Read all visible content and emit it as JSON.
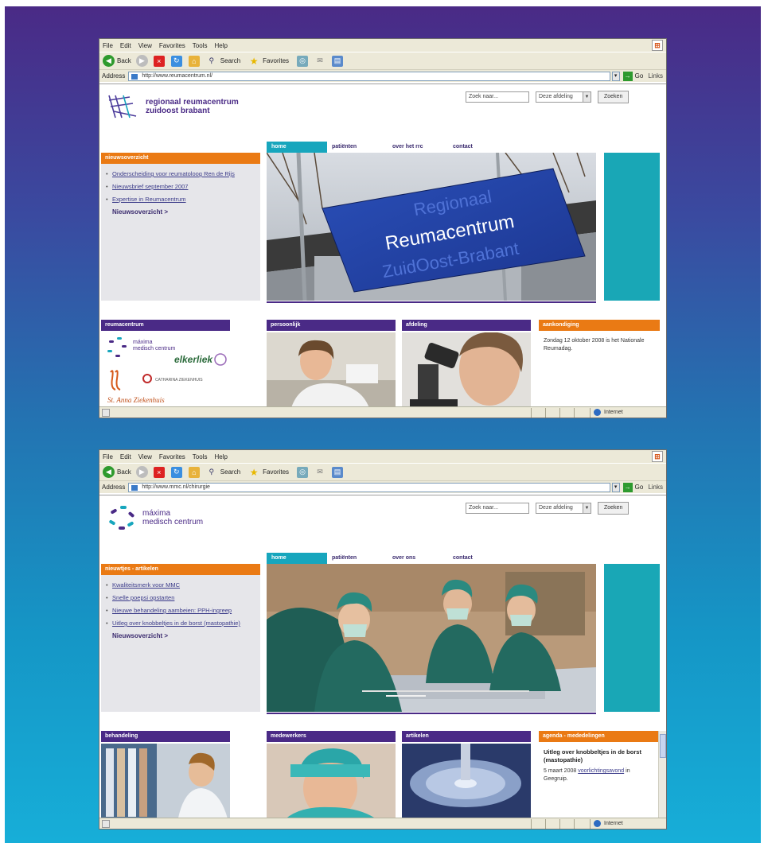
{
  "browser_chrome": {
    "menu": [
      "File",
      "Edit",
      "View",
      "Favorites",
      "Tools",
      "Help"
    ],
    "toolbar": {
      "back": "Back",
      "search": "Search",
      "favorites": "Favorites"
    },
    "address_label": "Address",
    "go_label": "Go",
    "links_label": "Links",
    "status_zone": "Internet"
  },
  "site1": {
    "address_url": "http://www.reumacentrum.nl/",
    "logo_line1": "regionaal reumacentrum",
    "logo_line2": "zuidoost brabant",
    "search": {
      "placeholder": "Zoek naar...",
      "select_value": "Deze afdeling",
      "button": "Zoeken"
    },
    "nav": [
      "home",
      "patiënten",
      "over het rrc",
      "contact"
    ],
    "news": {
      "title": "nieuwsoverzicht",
      "items": [
        "Onderscheiding voor reumatoloog Ren de Rijs",
        "Nieuwsbrief september 2007",
        "Expertise in Reumacentrum"
      ],
      "more": "Nieuwsoverzicht >"
    },
    "hero_sign": {
      "line1": "Regionaal",
      "line2": "Reumacentrum",
      "line3": "ZuidOost-Brabant"
    },
    "cards": [
      {
        "title": "reumacentrum"
      },
      {
        "title": "persoonlijk"
      },
      {
        "title": "afdeling"
      },
      {
        "title": "aankondiging"
      }
    ],
    "partner_logos": {
      "maxima_line1": "máxima",
      "maxima_line2": "medisch centrum",
      "elkerliek": "elkerliek",
      "catharina": "CATHARINA ZIEKENHUIS",
      "st_anna": "St. Anna Ziekenhuis"
    },
    "announcement": "Zondag 12 oktober 2008 is het Nationale Reumadag."
  },
  "site2": {
    "address_url": "http://www.mmc.nl/chirurgie",
    "logo_line1": "máxima",
    "logo_line2": "medisch centrum",
    "search": {
      "placeholder": "Zoek naar...",
      "select_value": "Deze afdeling",
      "button": "Zoeken"
    },
    "nav": [
      "home",
      "patiënten",
      "over ons",
      "contact"
    ],
    "news": {
      "title": "nieuwtjes - artikelen",
      "items": [
        "Kwaliteitsmerk voor MMC",
        "Snelle poepsi opstarten",
        "Nieuwe behandeling aambeien: PPH-ingreep",
        "Uitleg over knobbeltjes in de borst (mastopathie)"
      ],
      "more": "Nieuwsoverzicht >"
    },
    "cards": [
      {
        "title": "behandeling"
      },
      {
        "title": "medewerkers"
      },
      {
        "title": "artikelen"
      },
      {
        "title": "agenda - mededelingen"
      }
    ],
    "agenda": {
      "title": "Uitleg over knobbeltjes in de borst (mastopathie)",
      "text_prefix": "5 maart 2008",
      "link": "voorlichtingsavond",
      "text_suffix": "in Geegruip."
    }
  }
}
